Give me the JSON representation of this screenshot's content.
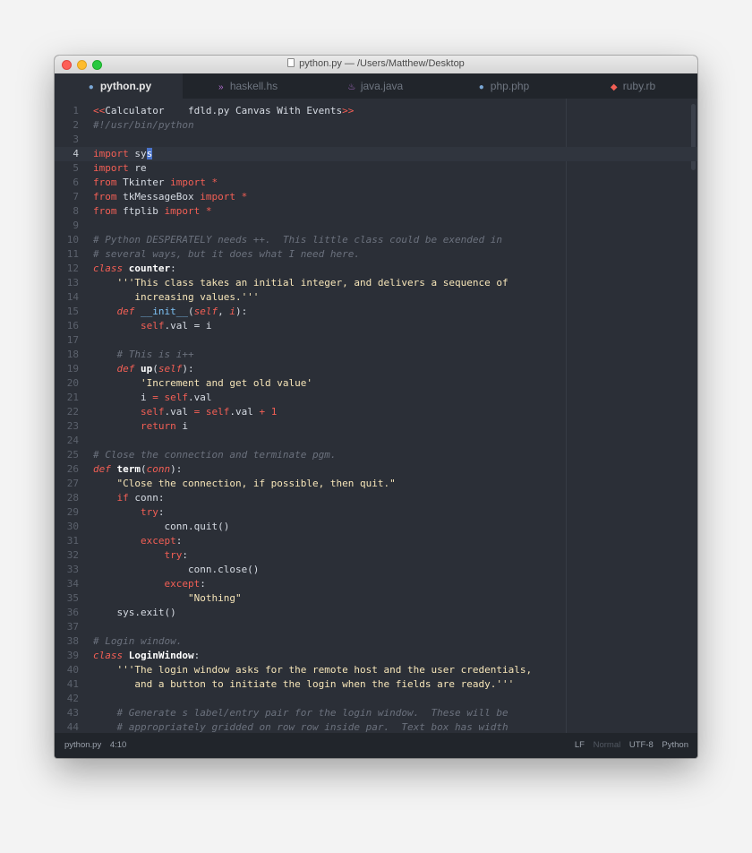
{
  "window": {
    "title": "python.py — /Users/Matthew/Desktop"
  },
  "tabs": [
    {
      "label": "python.py",
      "icon": "python-icon",
      "active": true
    },
    {
      "label": "haskell.hs",
      "icon": "haskell-icon",
      "active": false
    },
    {
      "label": "java.java",
      "icon": "java-icon",
      "active": false
    },
    {
      "label": "php.php",
      "icon": "php-icon",
      "active": false
    },
    {
      "label": "ruby.rb",
      "icon": "ruby-icon",
      "active": false
    }
  ],
  "editor": {
    "current_line": 4,
    "lines": [
      {
        "n": "1",
        "tokens": [
          {
            "t": "<<",
            "c": "keyword"
          },
          {
            "t": "Calculator    fdld.py Canvas With Events",
            "c": "plain"
          },
          {
            "t": ">>",
            "c": "keyword"
          }
        ]
      },
      {
        "n": "2",
        "tokens": [
          {
            "t": "#!/usr/bin/python",
            "c": "comment"
          }
        ]
      },
      {
        "n": "3",
        "tokens": []
      },
      {
        "n": "4",
        "tokens": [
          {
            "t": "import",
            "c": "keyword"
          },
          {
            "t": " sy",
            "c": "plain"
          },
          {
            "t": "s",
            "c": "cursor"
          }
        ]
      },
      {
        "n": "5",
        "tokens": [
          {
            "t": "import",
            "c": "keyword"
          },
          {
            "t": " re",
            "c": "plain"
          }
        ]
      },
      {
        "n": "6",
        "tokens": [
          {
            "t": "from",
            "c": "keyword"
          },
          {
            "t": " Tkinter ",
            "c": "plain"
          },
          {
            "t": "import",
            "c": "keyword"
          },
          {
            "t": " ",
            "c": "plain"
          },
          {
            "t": "*",
            "c": "keyword"
          }
        ]
      },
      {
        "n": "7",
        "tokens": [
          {
            "t": "from",
            "c": "keyword"
          },
          {
            "t": " tkMessageBox ",
            "c": "plain"
          },
          {
            "t": "import",
            "c": "keyword"
          },
          {
            "t": " ",
            "c": "plain"
          },
          {
            "t": "*",
            "c": "keyword"
          }
        ]
      },
      {
        "n": "8",
        "tokens": [
          {
            "t": "from",
            "c": "keyword"
          },
          {
            "t": " ftplib ",
            "c": "plain"
          },
          {
            "t": "import",
            "c": "keyword"
          },
          {
            "t": " ",
            "c": "plain"
          },
          {
            "t": "*",
            "c": "keyword"
          }
        ]
      },
      {
        "n": "9",
        "tokens": []
      },
      {
        "n": "10",
        "tokens": [
          {
            "t": "# Python DESPERATELY needs ++.  This little class could be exended in",
            "c": "comment"
          }
        ]
      },
      {
        "n": "11",
        "tokens": [
          {
            "t": "# several ways, but it does what I need here.",
            "c": "comment"
          }
        ]
      },
      {
        "n": "12",
        "tokens": [
          {
            "t": "class",
            "c": "kwital"
          },
          {
            "t": " ",
            "c": "plain"
          },
          {
            "t": "counter",
            "c": "func"
          },
          {
            "t": ":",
            "c": "plain"
          }
        ]
      },
      {
        "n": "13",
        "tokens": [
          {
            "t": "    ",
            "c": "plain"
          },
          {
            "t": "'''This class takes an initial integer, and delivers a sequence of",
            "c": "string"
          }
        ]
      },
      {
        "n": "14",
        "tokens": [
          {
            "t": "       increasing values.'''",
            "c": "string"
          }
        ]
      },
      {
        "n": "15",
        "tokens": [
          {
            "t": "    ",
            "c": "plain"
          },
          {
            "t": "def",
            "c": "kwital"
          },
          {
            "t": " ",
            "c": "plain"
          },
          {
            "t": "__init__",
            "c": "dunder"
          },
          {
            "t": "(",
            "c": "plain"
          },
          {
            "t": "self",
            "c": "selfp"
          },
          {
            "t": ", ",
            "c": "plain"
          },
          {
            "t": "i",
            "c": "selfp"
          },
          {
            "t": "):",
            "c": "plain"
          }
        ]
      },
      {
        "n": "16",
        "tokens": [
          {
            "t": "        ",
            "c": "plain"
          },
          {
            "t": "self",
            "c": "self"
          },
          {
            "t": ".val = i",
            "c": "plain"
          }
        ]
      },
      {
        "n": "17",
        "tokens": []
      },
      {
        "n": "18",
        "tokens": [
          {
            "t": "    ",
            "c": "plain"
          },
          {
            "t": "# This is i++",
            "c": "comment"
          }
        ]
      },
      {
        "n": "19",
        "tokens": [
          {
            "t": "    ",
            "c": "plain"
          },
          {
            "t": "def",
            "c": "kwital"
          },
          {
            "t": " ",
            "c": "plain"
          },
          {
            "t": "up",
            "c": "func"
          },
          {
            "t": "(",
            "c": "plain"
          },
          {
            "t": "self",
            "c": "selfp"
          },
          {
            "t": "):",
            "c": "plain"
          }
        ]
      },
      {
        "n": "20",
        "tokens": [
          {
            "t": "        ",
            "c": "plain"
          },
          {
            "t": "'Increment and get old value'",
            "c": "string"
          }
        ]
      },
      {
        "n": "21",
        "tokens": [
          {
            "t": "        i ",
            "c": "plain"
          },
          {
            "t": "=",
            "c": "keyword"
          },
          {
            "t": " ",
            "c": "plain"
          },
          {
            "t": "self",
            "c": "self"
          },
          {
            "t": ".val",
            "c": "plain"
          }
        ]
      },
      {
        "n": "22",
        "tokens": [
          {
            "t": "        ",
            "c": "plain"
          },
          {
            "t": "self",
            "c": "self"
          },
          {
            "t": ".val ",
            "c": "plain"
          },
          {
            "t": "=",
            "c": "keyword"
          },
          {
            "t": " ",
            "c": "plain"
          },
          {
            "t": "self",
            "c": "self"
          },
          {
            "t": ".val ",
            "c": "plain"
          },
          {
            "t": "+ 1",
            "c": "keyword"
          }
        ]
      },
      {
        "n": "23",
        "tokens": [
          {
            "t": "        ",
            "c": "plain"
          },
          {
            "t": "return",
            "c": "keyword"
          },
          {
            "t": " i",
            "c": "plain"
          }
        ]
      },
      {
        "n": "24",
        "tokens": []
      },
      {
        "n": "25",
        "tokens": [
          {
            "t": "# Close the connection and terminate pgm.",
            "c": "comment"
          }
        ]
      },
      {
        "n": "26",
        "tokens": [
          {
            "t": "def",
            "c": "kwital"
          },
          {
            "t": " ",
            "c": "plain"
          },
          {
            "t": "term",
            "c": "func"
          },
          {
            "t": "(",
            "c": "plain"
          },
          {
            "t": "conn",
            "c": "selfp"
          },
          {
            "t": "):",
            "c": "plain"
          }
        ]
      },
      {
        "n": "27",
        "tokens": [
          {
            "t": "    ",
            "c": "plain"
          },
          {
            "t": "\"Close the connection, if possible, then quit.\"",
            "c": "string"
          }
        ]
      },
      {
        "n": "28",
        "tokens": [
          {
            "t": "    ",
            "c": "plain"
          },
          {
            "t": "if",
            "c": "keyword"
          },
          {
            "t": " conn:",
            "c": "plain"
          }
        ]
      },
      {
        "n": "29",
        "tokens": [
          {
            "t": "        ",
            "c": "plain"
          },
          {
            "t": "try",
            "c": "keyword"
          },
          {
            "t": ":",
            "c": "plain"
          }
        ]
      },
      {
        "n": "30",
        "tokens": [
          {
            "t": "            conn.quit()",
            "c": "plain"
          }
        ]
      },
      {
        "n": "31",
        "tokens": [
          {
            "t": "        ",
            "c": "plain"
          },
          {
            "t": "except",
            "c": "keyword"
          },
          {
            "t": ":",
            "c": "plain"
          }
        ]
      },
      {
        "n": "32",
        "tokens": [
          {
            "t": "            ",
            "c": "plain"
          },
          {
            "t": "try",
            "c": "keyword"
          },
          {
            "t": ":",
            "c": "plain"
          }
        ]
      },
      {
        "n": "33",
        "tokens": [
          {
            "t": "                conn.close()",
            "c": "plain"
          }
        ]
      },
      {
        "n": "34",
        "tokens": [
          {
            "t": "            ",
            "c": "plain"
          },
          {
            "t": "except",
            "c": "keyword"
          },
          {
            "t": ":",
            "c": "plain"
          }
        ]
      },
      {
        "n": "35",
        "tokens": [
          {
            "t": "                ",
            "c": "plain"
          },
          {
            "t": "\"Nothing\"",
            "c": "string"
          }
        ]
      },
      {
        "n": "36",
        "tokens": [
          {
            "t": "    sys.exit()",
            "c": "plain"
          }
        ]
      },
      {
        "n": "37",
        "tokens": []
      },
      {
        "n": "38",
        "tokens": [
          {
            "t": "# Login window.",
            "c": "comment"
          }
        ]
      },
      {
        "n": "39",
        "tokens": [
          {
            "t": "class",
            "c": "kwital"
          },
          {
            "t": " ",
            "c": "plain"
          },
          {
            "t": "LoginWindow",
            "c": "func"
          },
          {
            "t": ":",
            "c": "plain"
          }
        ]
      },
      {
        "n": "40",
        "tokens": [
          {
            "t": "    ",
            "c": "plain"
          },
          {
            "t": "'''The login window asks for the remote host and the user credentials,",
            "c": "string"
          }
        ]
      },
      {
        "n": "41",
        "tokens": [
          {
            "t": "       and a button to initiate the login when the fields are ready.'''",
            "c": "string"
          }
        ]
      },
      {
        "n": "42",
        "tokens": []
      },
      {
        "n": "43",
        "tokens": [
          {
            "t": "    ",
            "c": "plain"
          },
          {
            "t": "# Generate s label/entry pair for the login window.  These will be",
            "c": "comment"
          }
        ]
      },
      {
        "n": "44",
        "tokens": [
          {
            "t": "    ",
            "c": "plain"
          },
          {
            "t": "# appropriately gridded on row row inside par.  Text box has width",
            "c": "comment"
          }
        ]
      }
    ]
  },
  "status": {
    "file": "python.py",
    "position": "4:10",
    "line_ending": "LF",
    "mode": "Normal",
    "encoding": "UTF-8",
    "grammar": "Python"
  },
  "colors": {
    "background": "#2b2f37",
    "keyword": "#f35f55",
    "comment": "#6b717d",
    "string": "#f6e5b8",
    "cursor": "#4a73c9"
  }
}
